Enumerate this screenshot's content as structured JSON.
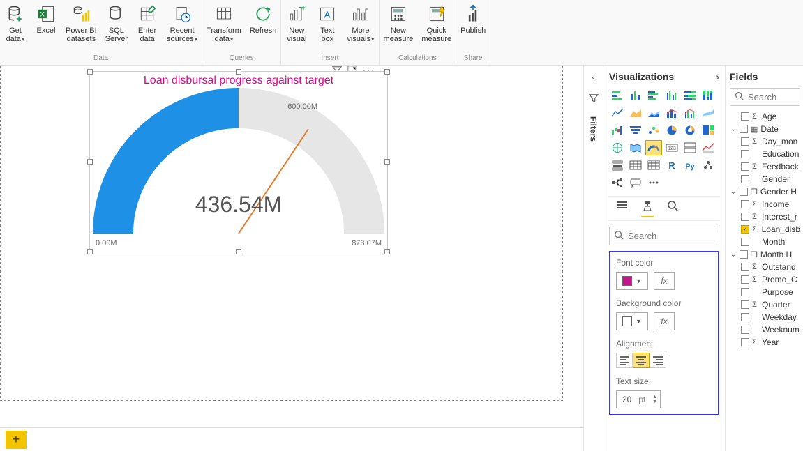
{
  "ribbon": {
    "groups": {
      "data": {
        "label": "Data",
        "items": {
          "get_data": "Get\ndata",
          "excel": "Excel",
          "pbi_ds": "Power BI\ndatasets",
          "sql": "SQL\nServer",
          "enter": "Enter\ndata",
          "recent": "Recent\nsources"
        }
      },
      "queries": {
        "label": "Queries",
        "items": {
          "transform": "Transform\ndata",
          "refresh": "Refresh"
        }
      },
      "insert": {
        "label": "Insert",
        "items": {
          "new_visual": "New\nvisual",
          "text_box": "Text\nbox",
          "more_visuals": "More\nvisuals"
        }
      },
      "calculations": {
        "label": "Calculations",
        "items": {
          "new_measure": "New\nmeasure",
          "quick_measure": "Quick\nmeasure"
        }
      },
      "share": {
        "label": "Share",
        "items": {
          "publish": "Publish"
        }
      }
    }
  },
  "visual": {
    "title": "Loan disbursal progress against target",
    "value": "436.54M",
    "min": "0.00M",
    "max": "873.07M",
    "target": "600.00M",
    "title_color": "#e3008c"
  },
  "chart_data": {
    "type": "gauge",
    "min": 0.0,
    "max": 873.07,
    "value": 436.54,
    "target": 600.0,
    "unit": "M",
    "title": "Loan disbursal progress against target"
  },
  "filters_pane": {
    "label": "Filters"
  },
  "viz_pane": {
    "title": "Visualizations",
    "search_placeholder": "Search",
    "format": {
      "font_color_label": "Font color",
      "font_color": "#e3008c",
      "bg_color_label": "Background color",
      "bg_color": "#ffffff",
      "alignment_label": "Alignment",
      "alignment": "center",
      "text_size_label": "Text size",
      "text_size": "20",
      "text_size_unit": "pt",
      "fx": "fx"
    }
  },
  "fields_pane": {
    "title": "Fields",
    "search_placeholder": "Search",
    "items": [
      {
        "kind": "field",
        "sigma": true,
        "label": "Age",
        "indent": 1
      },
      {
        "kind": "table",
        "label": "Date",
        "expanded": true
      },
      {
        "kind": "field",
        "sigma": true,
        "label": "Day_mon",
        "indent": 1
      },
      {
        "kind": "field",
        "sigma": false,
        "label": "Education",
        "indent": 1
      },
      {
        "kind": "field",
        "sigma": true,
        "label": "Feedback",
        "indent": 1
      },
      {
        "kind": "field",
        "sigma": false,
        "label": "Gender",
        "indent": 1
      },
      {
        "kind": "table",
        "label": "Gender H",
        "expanded": true,
        "hier": true
      },
      {
        "kind": "field",
        "sigma": true,
        "label": "Income",
        "indent": 1
      },
      {
        "kind": "field",
        "sigma": true,
        "label": "Interest_r",
        "indent": 1
      },
      {
        "kind": "field",
        "sigma": true,
        "label": "Loan_disb",
        "indent": 1,
        "checked": true
      },
      {
        "kind": "field",
        "sigma": false,
        "label": "Month",
        "indent": 1
      },
      {
        "kind": "table",
        "label": "Month H",
        "expanded": true,
        "hier": true
      },
      {
        "kind": "field",
        "sigma": true,
        "label": "Outstand",
        "indent": 1
      },
      {
        "kind": "field",
        "sigma": true,
        "label": "Promo_C",
        "indent": 1
      },
      {
        "kind": "field",
        "sigma": false,
        "label": "Purpose",
        "indent": 1
      },
      {
        "kind": "field",
        "sigma": true,
        "label": "Quarter",
        "indent": 1
      },
      {
        "kind": "field",
        "sigma": false,
        "label": "Weekday",
        "indent": 1
      },
      {
        "kind": "field",
        "sigma": false,
        "label": "Weeknum",
        "indent": 1
      },
      {
        "kind": "field",
        "sigma": true,
        "label": "Year",
        "indent": 1
      }
    ]
  }
}
